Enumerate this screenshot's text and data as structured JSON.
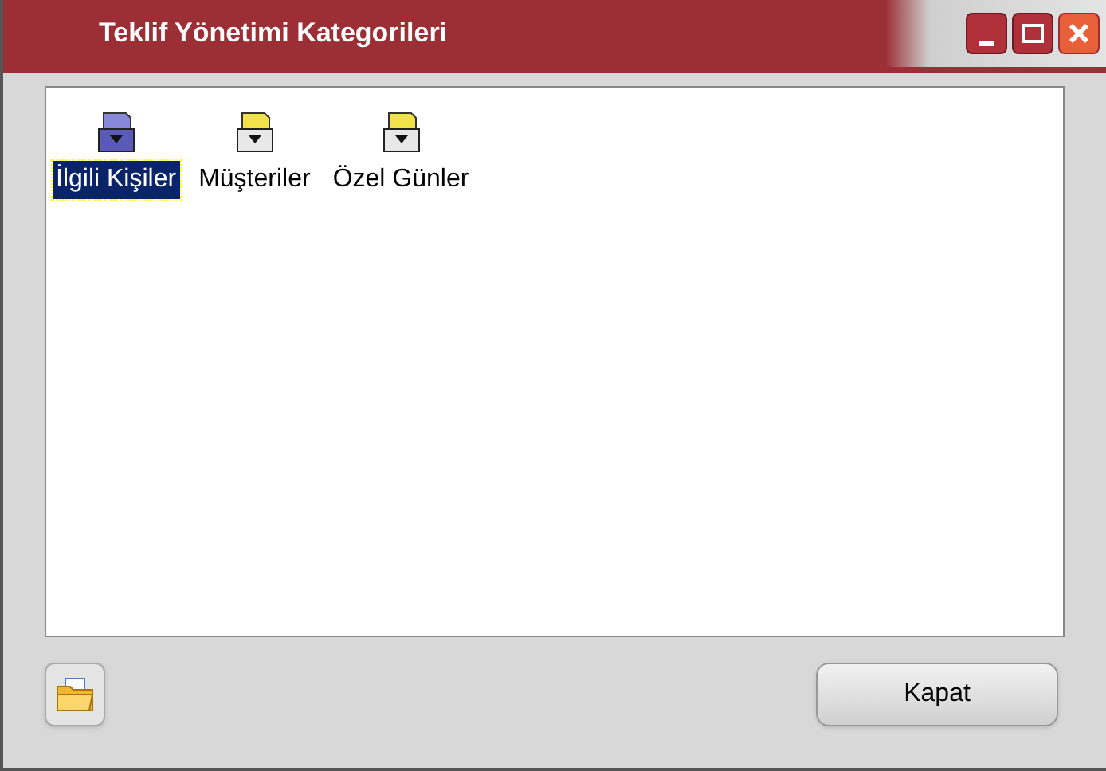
{
  "window": {
    "title": "Teklif Yönetimi Kategorileri"
  },
  "items": [
    {
      "label": "İlgili Kişiler",
      "selected": true
    },
    {
      "label": "Müşteriler",
      "selected": false
    },
    {
      "label": "Özel Günler",
      "selected": false
    }
  ],
  "buttons": {
    "close": "Kapat"
  }
}
